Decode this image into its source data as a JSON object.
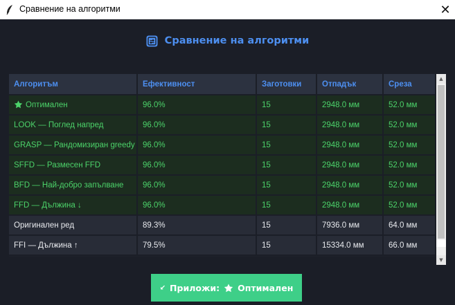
{
  "window": {
    "title": "Сравнение на алгоритми",
    "close_glyph": "✕"
  },
  "heading": {
    "text": "Сравнение на алгоритми",
    "icon": "compare-icon"
  },
  "table": {
    "columns": [
      "Алгоритъм",
      "Ефективност",
      "Заготовки",
      "Отпадък",
      "Среза"
    ],
    "rows": [
      {
        "algorithm": "Оптимален",
        "efficiency": "96.0%",
        "blanks": "15",
        "waste": "2948.0 мм",
        "cuts": "52.0 мм",
        "highlight": true,
        "icon": "star-icon"
      },
      {
        "algorithm": "LOOK — Поглед напред",
        "efficiency": "96.0%",
        "blanks": "15",
        "waste": "2948.0 мм",
        "cuts": "52.0 мм",
        "highlight": true
      },
      {
        "algorithm": "GRASP — Рандомизиран greedy",
        "efficiency": "96.0%",
        "blanks": "15",
        "waste": "2948.0 мм",
        "cuts": "52.0 мм",
        "highlight": true
      },
      {
        "algorithm": "SFFD — Размесен FFD",
        "efficiency": "96.0%",
        "blanks": "15",
        "waste": "2948.0 мм",
        "cuts": "52.0 мм",
        "highlight": true
      },
      {
        "algorithm": "BFD — Най-добро запълване",
        "efficiency": "96.0%",
        "blanks": "15",
        "waste": "2948.0 мм",
        "cuts": "52.0 мм",
        "highlight": true
      },
      {
        "algorithm": "FFD — Дължина ↓",
        "efficiency": "96.0%",
        "blanks": "15",
        "waste": "2948.0 мм",
        "cuts": "52.0 мм",
        "highlight": true
      },
      {
        "algorithm": "Оригинален ред",
        "efficiency": "89.3%",
        "blanks": "15",
        "waste": "7936.0 мм",
        "cuts": "64.0 мм",
        "highlight": false
      },
      {
        "algorithm": "FFI — Дължина ↑",
        "efficiency": "79.5%",
        "blanks": "15",
        "waste": "15334.0 мм",
        "cuts": "66.0 мм",
        "highlight": false
      }
    ]
  },
  "apply_button": {
    "prefix": "Приложи:",
    "value": "Оптимален",
    "arrow_glyph": "↙",
    "icon": "star-icon"
  },
  "colors": {
    "accent": "#4d8ff0",
    "best": "#4cd36a",
    "button": "#3ecf88",
    "background": "#1b1e27"
  }
}
